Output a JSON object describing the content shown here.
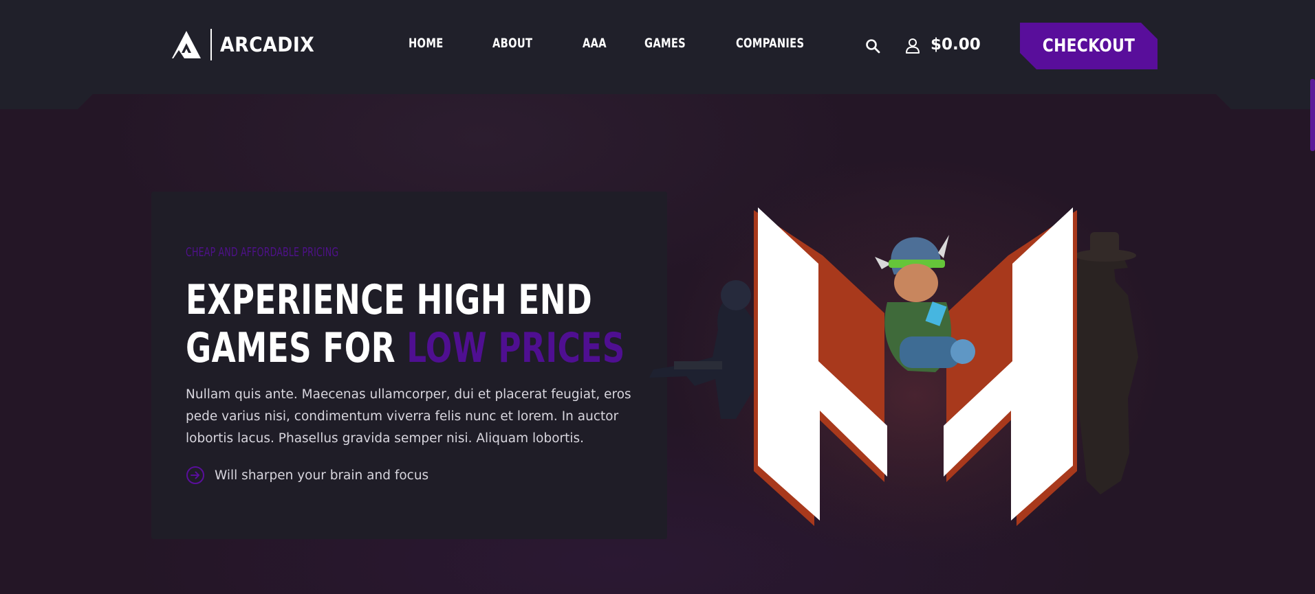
{
  "brand": {
    "name": "ARCADIX",
    "logo_icon": "triangle-logo-icon"
  },
  "nav": {
    "items": [
      {
        "label": "HOME"
      },
      {
        "label": "ABOUT"
      },
      {
        "label": "AAA"
      },
      {
        "label": "GAMES"
      },
      {
        "label": "COMPANIES"
      }
    ]
  },
  "header": {
    "search_icon": "search-icon",
    "user_icon": "user-icon",
    "cart_total": "$0.00",
    "checkout_label": "CHECKOUT"
  },
  "hero": {
    "eyebrow": "CHEAP AND AFFORDABLE PRICING",
    "headline_line1": "EXPERIENCE HIGH END",
    "headline_line2_prefix": "GAMES FOR ",
    "headline_line2_accent": "LOW PRICES",
    "body": "Nullam quis ante. Maecenas ullamcorper, dui et placerat feugiat, eros pede varius nisi, condimentum viverra felis nunc et lorem. In auctor lobortis lacus. Phasellus gravida semper nisi. Aliquam lobortis.",
    "feature_icon": "arrow-circle-right-icon",
    "feature_text": "Will sharpen your brain and focus"
  },
  "colors": {
    "accent": "#590e9b",
    "header_bg": "#20202a",
    "card_bg": "#1f1d27",
    "page_bg": "#241626",
    "logo_m_edge": "#a8391c"
  }
}
